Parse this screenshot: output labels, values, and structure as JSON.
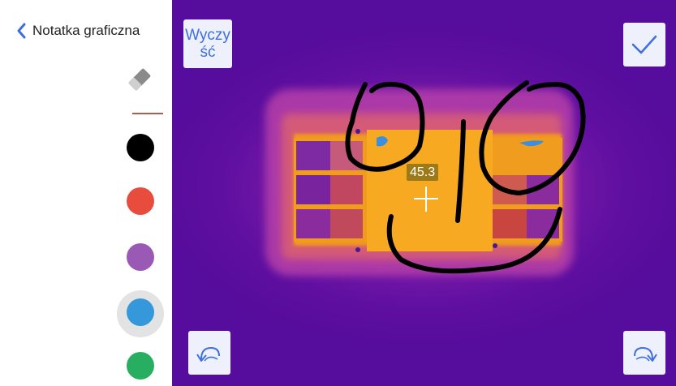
{
  "header": {
    "title": "Notatka graficzna"
  },
  "toolbar": {
    "clear_label_line1": "Wyczy",
    "clear_label_line2": "ść"
  },
  "palette": {
    "colors": [
      "#000000",
      "#e74c3c",
      "#9b59b6",
      "#3498db",
      "#27ae60"
    ],
    "selected_index": 3
  },
  "thermal": {
    "spot_temperature": "45.3"
  },
  "icons": {
    "back": "chevron-left-icon",
    "eraser": "eraser-icon",
    "confirm": "check-icon",
    "undo": "undo-icon",
    "redo": "redo-icon",
    "crosshair": "crosshair-icon"
  },
  "colors": {
    "accent": "#3e6fe0",
    "button_bg": "#eef0fb"
  }
}
